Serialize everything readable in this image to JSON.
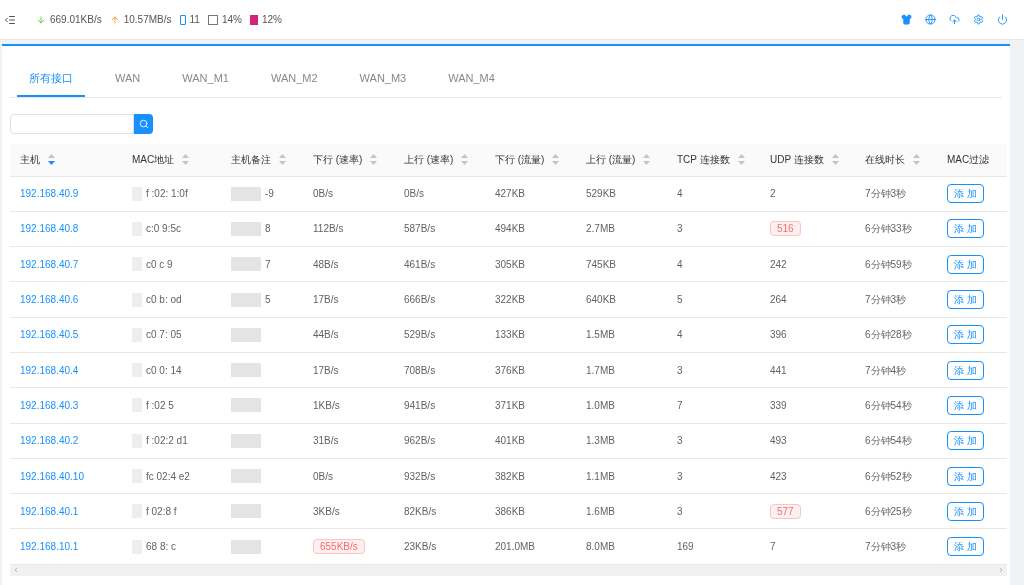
{
  "topbar": {
    "download": "669.01KB/s",
    "upload": "10.57MB/s",
    "devices": "11",
    "cpu": "14%",
    "memory": "12%"
  },
  "tabs": [
    {
      "label": "所有接口",
      "selected": true
    },
    {
      "label": "WAN",
      "selected": false
    },
    {
      "label": "WAN_M1",
      "selected": false
    },
    {
      "label": "WAN_M2",
      "selected": false
    },
    {
      "label": "WAN_M3",
      "selected": false
    },
    {
      "label": "WAN_M4",
      "selected": false
    }
  ],
  "table": {
    "columns": [
      {
        "label": "主机",
        "sortable": true,
        "sort_desc": true
      },
      {
        "label": "MAC地址",
        "sortable": true,
        "sort_desc": false
      },
      {
        "label": "主机备注",
        "sortable": true,
        "sort_desc": false
      },
      {
        "label": "下行 (速率)",
        "sortable": true,
        "sort_desc": false
      },
      {
        "label": "上行 (速率)",
        "sortable": true,
        "sort_desc": false
      },
      {
        "label": "下行 (流量)",
        "sortable": true,
        "sort_desc": false
      },
      {
        "label": "上行 (流量)",
        "sortable": true,
        "sort_desc": false
      },
      {
        "label": "TCP 连接数",
        "sortable": true,
        "sort_desc": false
      },
      {
        "label": "UDP 连接数",
        "sortable": true,
        "sort_desc": false
      },
      {
        "label": "在线时长",
        "sortable": true,
        "sort_desc": false
      },
      {
        "label": "MAC过滤",
        "sortable": false
      }
    ],
    "rows": [
      {
        "host": "192.168.40.9",
        "mac": "f :02: 1:0f",
        "note": "-9",
        "down_rate": "0B/s",
        "down_rate_alert": false,
        "up_rate": "0B/s",
        "down_total": "427KB",
        "up_total": "529KB",
        "tcp": "4",
        "udp": "2",
        "udp_alert": false,
        "online": "7分钟3秒",
        "action": "添 加"
      },
      {
        "host": "192.168.40.8",
        "mac": "c:0 9:5c",
        "note": "8",
        "down_rate": "112B/s",
        "down_rate_alert": false,
        "up_rate": "587B/s",
        "down_total": "494KB",
        "up_total": "2.7MB",
        "tcp": "3",
        "udp": "516",
        "udp_alert": true,
        "online": "6分钟33秒",
        "action": "添 加"
      },
      {
        "host": "192.168.40.7",
        "mac": "c0 c 9",
        "note": "7",
        "down_rate": "48B/s",
        "down_rate_alert": false,
        "up_rate": "461B/s",
        "down_total": "305KB",
        "up_total": "745KB",
        "tcp": "4",
        "udp": "242",
        "udp_alert": false,
        "online": "6分钟59秒",
        "action": "添 加"
      },
      {
        "host": "192.168.40.6",
        "mac": "c0 b: od",
        "note": "5",
        "down_rate": "17B/s",
        "down_rate_alert": false,
        "up_rate": "666B/s",
        "down_total": "322KB",
        "up_total": "640KB",
        "tcp": "5",
        "udp": "264",
        "udp_alert": false,
        "online": "7分钟3秒",
        "action": "添 加"
      },
      {
        "host": "192.168.40.5",
        "mac": "c0 7: 05",
        "down_rate": "44B/s",
        "down_rate_alert": false,
        "up_rate": "529B/s",
        "down_total": "133KB",
        "up_total": "1.5MB",
        "tcp": "4",
        "udp": "396",
        "udp_alert": false,
        "online": "6分钟28秒",
        "action": "添 加"
      },
      {
        "host": "192.168.40.4",
        "mac": "c0 0: 14",
        "down_rate": "17B/s",
        "down_rate_alert": false,
        "up_rate": "708B/s",
        "down_total": "376KB",
        "up_total": "1.7MB",
        "tcp": "3",
        "udp": "441",
        "udp_alert": false,
        "online": "7分钟4秒",
        "action": "添 加"
      },
      {
        "host": "192.168.40.3",
        "mac": "f :02 5",
        "down_rate": "1KB/s",
        "down_rate_alert": false,
        "up_rate": "941B/s",
        "down_total": "371KB",
        "up_total": "1.0MB",
        "tcp": "7",
        "udp": "339",
        "udp_alert": false,
        "online": "6分钟54秒",
        "action": "添 加"
      },
      {
        "host": "192.168.40.2",
        "mac": "f :02:2 d1",
        "down_rate": "31B/s",
        "down_rate_alert": false,
        "up_rate": "962B/s",
        "down_total": "401KB",
        "up_total": "1.3MB",
        "tcp": "3",
        "udp": "493",
        "udp_alert": false,
        "online": "6分钟54秒",
        "action": "添 加"
      },
      {
        "host": "192.168.40.10",
        "mac": "fc 02:4 e2",
        "down_rate": "0B/s",
        "down_rate_alert": false,
        "up_rate": "932B/s",
        "down_total": "382KB",
        "up_total": "1.1MB",
        "tcp": "3",
        "udp": "423",
        "udp_alert": false,
        "online": "6分钟52秒",
        "action": "添 加"
      },
      {
        "host": "192.168.40.1",
        "mac": "f 02:8 f",
        "down_rate": "3KB/s",
        "down_rate_alert": false,
        "up_rate": "82KB/s",
        "down_total": "386KB",
        "up_total": "1.6MB",
        "tcp": "3",
        "udp": "577",
        "udp_alert": true,
        "online": "6分钟25秒",
        "action": "添 加"
      },
      {
        "host": "192.168.10.1",
        "mac": "68 8: c",
        "down_rate": "655KB/s",
        "down_rate_alert": true,
        "up_rate": "23KB/s",
        "down_total": "201.0MB",
        "up_total": "8.0MB",
        "tcp": "169",
        "udp": "7",
        "udp_alert": false,
        "online": "7分钟3秒",
        "action": "添 加"
      }
    ]
  }
}
